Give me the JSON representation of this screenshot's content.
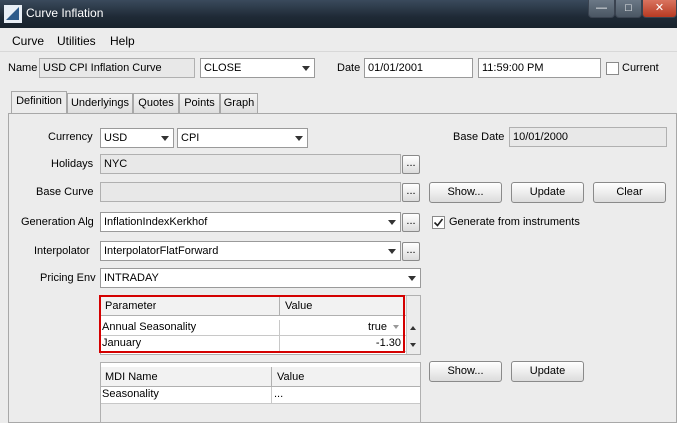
{
  "window": {
    "title": "Curve Inflation",
    "min_symbol": "—",
    "max_symbol": "□",
    "close_symbol": "✕"
  },
  "menu": [
    "Curve",
    "Utilities",
    "Help"
  ],
  "header": {
    "name_label": "Name",
    "name_value": "USD CPI Inflation Curve",
    "close_value": "CLOSE",
    "date_label": "Date",
    "date_value": "01/01/2001",
    "time_value": "11:59:00 PM",
    "current_label": "Current"
  },
  "tabs": [
    "Definition",
    "Underlyings",
    "Quotes",
    "Points",
    "Graph"
  ],
  "active_tab": "Definition",
  "definition": {
    "currency_label": "Currency",
    "currency_value": "USD",
    "index_value": "CPI",
    "base_date_label": "Base Date",
    "base_date_value": "10/01/2000",
    "holidays_label": "Holidays",
    "holidays_value": "NYC",
    "base_curve_label": "Base Curve",
    "base_curve_value": "",
    "show_label": "Show...",
    "update_label": "Update",
    "clear_label": "Clear",
    "generation_label": "Generation Alg",
    "generation_value": "InflationIndexKerkhof",
    "generate_from_instruments_label": "Generate from instruments",
    "interpolator_label": "Interpolator",
    "interpolator_value": "InterpolatorFlatForward",
    "pricing_env_label": "Pricing Env",
    "pricing_env_value": "INTRADAY",
    "ellipsis": "...",
    "param_table": {
      "headers": [
        "Parameter",
        "Value"
      ],
      "rows": [
        {
          "param": "Annual Seasonality",
          "value": "true"
        },
        {
          "param": "January",
          "value": "-1.30"
        }
      ]
    },
    "mdi_table": {
      "headers": [
        "MDI Name",
        "Value"
      ],
      "rows": [
        {
          "name": "Seasonality",
          "value": "..."
        }
      ]
    },
    "mdi_show_label": "Show...",
    "mdi_update_label": "Update"
  },
  "colors": {
    "highlight_border": "#d40000",
    "titlebar": "#1f2a36"
  }
}
